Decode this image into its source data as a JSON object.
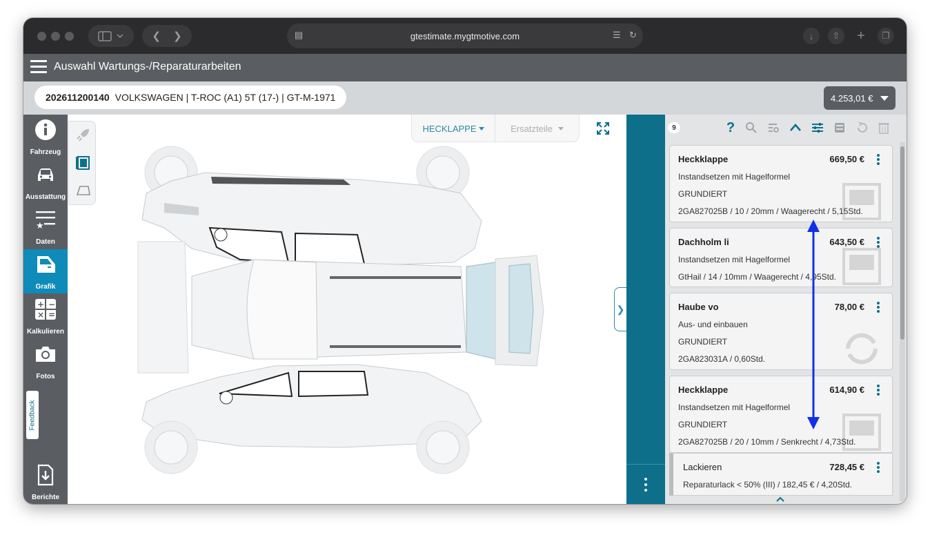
{
  "browser": {
    "url": "gtestimate.mygtmotive.com"
  },
  "app": {
    "title": "Auswahl Wartungs-/Reparaturarbeiten",
    "vehicle_id": "202611200140",
    "vehicle_desc": "VOLKSWAGEN | T-ROC (A1) 5T (17-) | GT-M-1971",
    "total": "4.253,01 €"
  },
  "sidebar": {
    "items": [
      {
        "label": "Fahrzeug",
        "icon": "info-icon"
      },
      {
        "label": "Ausstattung",
        "icon": "car-icon"
      },
      {
        "label": "Daten",
        "icon": "list-star-icon"
      },
      {
        "label": "Grafik",
        "icon": "car-door-icon",
        "active": true
      },
      {
        "label": "Kalkulieren",
        "icon": "calculator-icon"
      },
      {
        "label": "Fotos",
        "icon": "camera-icon"
      },
      {
        "label": "Berichte",
        "icon": "download-document-icon"
      }
    ],
    "feedback": "Feedback"
  },
  "graphic": {
    "part_select": "HECKLAPPE",
    "parts_select": "Ersatzteile"
  },
  "panel": {
    "count": "9",
    "cards": [
      {
        "title": "Heckklappe",
        "price": "669,50 €",
        "lines": [
          "Instandsetzen mit Hagelformel",
          "GRUNDIERT",
          "2GA827025B / 10 / 20mm / Waagerecht / 5,15Std."
        ]
      },
      {
        "title": "Dachholm li",
        "price": "643,50 €",
        "lines": [
          "Instandsetzen mit Hagelformel",
          "GtHail / 14 / 10mm / Waagerecht / 4,95Std."
        ]
      },
      {
        "title": "Haube vo",
        "price": "78,00 €",
        "lines": [
          "Aus- und einbauen",
          "GRUNDIERT",
          "2GA823031A / 0,60Std."
        ]
      },
      {
        "title": "Heckklappe",
        "price": "614,90 €",
        "lines": [
          "Instandsetzen mit Hagelformel",
          "GRUNDIERT",
          "2GA827025B / 20 / 10mm / Senkrecht / 4,73Std."
        ]
      }
    ],
    "sub_card": {
      "title": "Lackieren",
      "price": "728,45 €",
      "line": "Reparaturlack < 50% (III) / 182,45 € / 4,20Std."
    }
  },
  "colors": {
    "accent": "#0e8bb8",
    "teal": "#0e6f8a",
    "annotation_arrow": "#1030e8"
  }
}
